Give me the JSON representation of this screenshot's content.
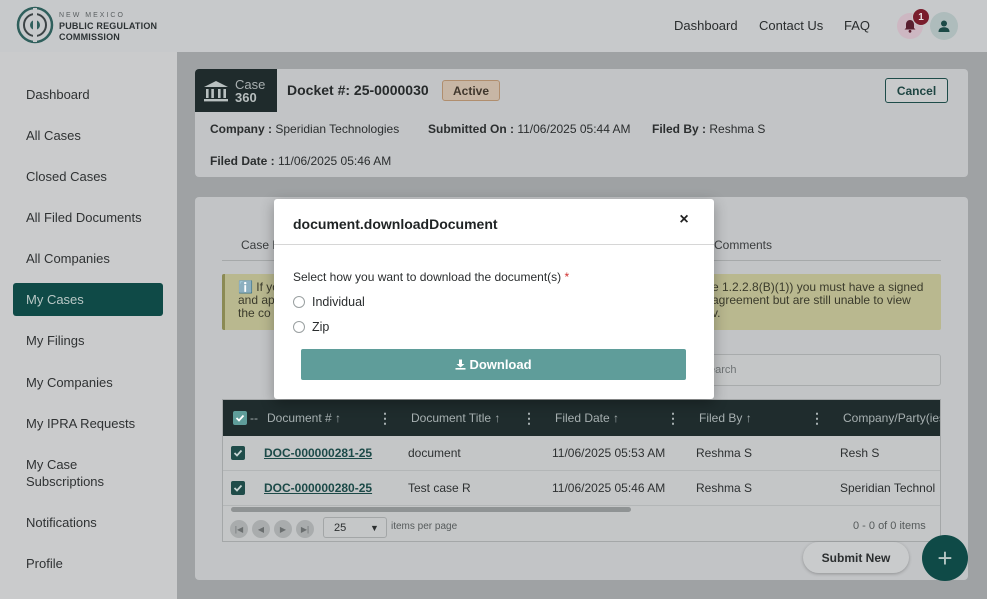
{
  "header": {
    "logo_small": "NEW MEXICO",
    "logo_line1": "PUBLIC REGULATION",
    "logo_line2": "COMMISSION",
    "nav": [
      "Dashboard",
      "Contact Us",
      "FAQ"
    ],
    "notification_count": "1"
  },
  "sidebar": {
    "items": [
      {
        "label": "Dashboard"
      },
      {
        "label": "All Cases"
      },
      {
        "label": "Closed Cases"
      },
      {
        "label": "All Filed Documents"
      },
      {
        "label": "All Companies"
      },
      {
        "label": "My Cases",
        "active": true
      },
      {
        "label": "My Filings"
      },
      {
        "label": "My Companies"
      },
      {
        "label": "My IPRA Requests"
      },
      {
        "label": "My Case Subscriptions"
      },
      {
        "label": "Notifications"
      },
      {
        "label": "Profile"
      }
    ]
  },
  "case": {
    "badge_line1": "Case",
    "badge_line2": "360",
    "docket": "Docket #: 25-0000030",
    "status": "Active",
    "cancel_label": "Cancel",
    "company_label": "Company :",
    "company_value": "Speridian Technologies",
    "submitted_label": "Submitted On :",
    "submitted_value": "11/06/2025 05:44 AM",
    "filed_by_label": "Filed By :",
    "filed_by_value": "Reshma S",
    "filed_date_label": "Filed Date :",
    "filed_date_value": "11/06/2025 05:46 AM"
  },
  "tabs": {
    "left_partial": "Case E",
    "right": "Comments"
  },
  "notice": {
    "left_line1": "ℹ️ If yo",
    "left_line2": "and ap",
    "left_line3": "the co",
    "right_line1": "e 1.2.2.8(B)(1)) you must have a signed",
    "right_line2": "agreement but are still unable to view",
    "right_line3": "v."
  },
  "search": {
    "placeholder_partial": "earch"
  },
  "table": {
    "columns": [
      "Document #",
      "Document Title",
      "Filed Date",
      "Filed By",
      "Company/Party(ies"
    ],
    "rows": [
      {
        "doc": "DOC-000000281-25",
        "title": "document",
        "date": "11/06/2025 05:53 AM",
        "by": "Reshma S",
        "company": "Resh S"
      },
      {
        "doc": "DOC-000000280-25",
        "title": "Test case R",
        "date": "11/06/2025 05:46 AM",
        "by": "Reshma S",
        "company": "Speridian Technol"
      }
    ],
    "page_size": "25",
    "items_per_page": "items per page",
    "count": "0 - 0 of 0 items"
  },
  "actions": {
    "submit_new": "Submit New",
    "fab": "+"
  },
  "modal": {
    "title": "document.downloadDocument",
    "close": "×",
    "question": "Select how you want to download the document(s)",
    "required_mark": "*",
    "options": [
      "Individual",
      "Zip"
    ],
    "download_label": "Download"
  }
}
